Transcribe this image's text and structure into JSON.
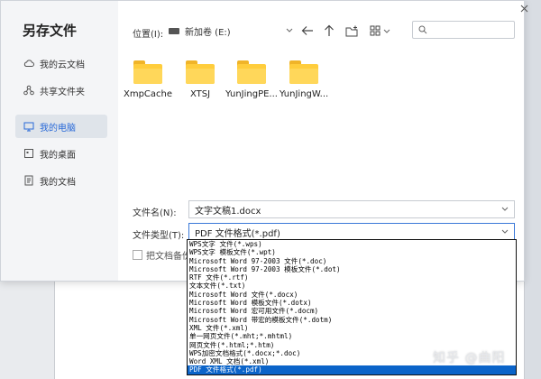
{
  "dialog": {
    "title": "另存文件"
  },
  "sidebar": {
    "items": [
      {
        "label": "我的云文档",
        "icon": "cloud-icon"
      },
      {
        "label": "共享文件夹",
        "icon": "share-icon"
      },
      {
        "label": "我的电脑",
        "icon": "computer-icon",
        "active": true
      },
      {
        "label": "我的桌面",
        "icon": "desktop-icon"
      },
      {
        "label": "我的文档",
        "icon": "document-icon"
      }
    ]
  },
  "toolbar": {
    "location_label": "位置(I):",
    "location_value": "新加卷 (E:)",
    "search_placeholder": ""
  },
  "folders": [
    {
      "name": "XmpCache"
    },
    {
      "name": "XTSJ"
    },
    {
      "name": "YunJingPE..."
    },
    {
      "name": "YunJingW..."
    }
  ],
  "form": {
    "filename_label": "文件名(N):",
    "filename_value": "文字文稿1.docx",
    "filetype_label": "文件类型(T):",
    "filetype_value": "PDF 文件格式(*.pdf)",
    "backup_label": "把文档备份到"
  },
  "dropdown": {
    "options": [
      "WPS文字 文件(*.wps)",
      "WPS文字 模板文件(*.wpt)",
      "Microsoft Word 97-2003 文件(*.doc)",
      "Microsoft Word 97-2003 模板文件(*.dot)",
      "RTF 文件(*.rtf)",
      "文本文件(*.txt)",
      "Microsoft Word 文件(*.docx)",
      "Microsoft Word 模板文件(*.dotx)",
      "Microsoft Word 宏可用文件(*.docm)",
      "Microsoft Word 带宏的模板文件(*.dotm)",
      "XML 文件(*.xml)",
      "单一网页文件(*.mht;*.mhtml)",
      "网页文件(*.html;*.htm)",
      "WPS加密文档格式(*.docx;*.doc)",
      "Word XML 文档(*.xml)",
      "PDF 文件格式(*.pdf)"
    ],
    "selected_index": 15
  },
  "watermark": "知乎 @曲阳",
  "colors": {
    "accent": "#2a6ad8",
    "selection": "#0b64c9",
    "folder": "#ffcd3c"
  }
}
